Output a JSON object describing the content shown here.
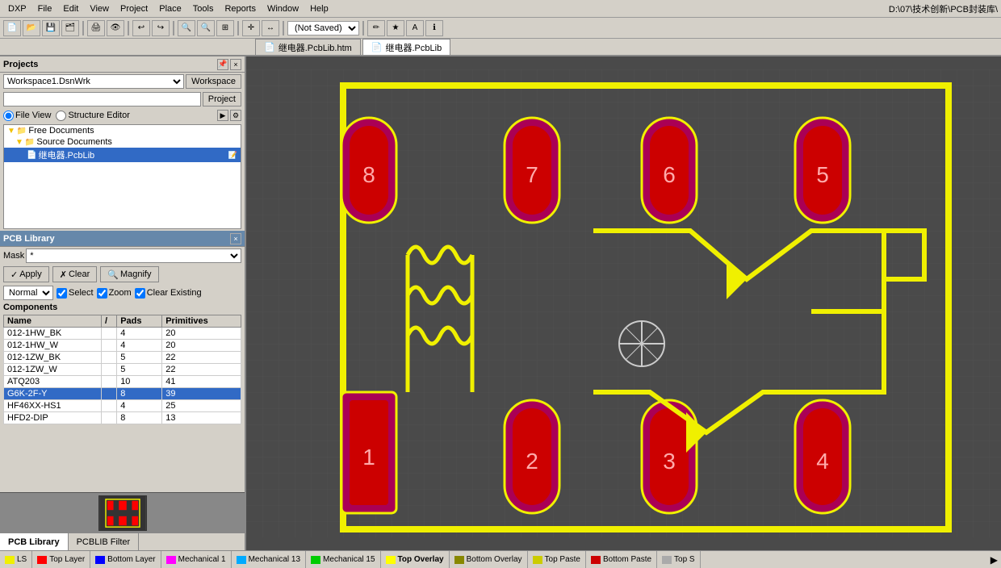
{
  "menubar": {
    "items": [
      "DXP",
      "File",
      "Edit",
      "View",
      "Project",
      "Place",
      "Tools",
      "Reports",
      "Window",
      "Help"
    ]
  },
  "toolbar": {
    "title_path": "D:\\07\\技术创新\\PCB封装库\\",
    "saved_state": "(Not Saved)"
  },
  "tabs": [
    {
      "label": "继电器.PcbLib.htm",
      "icon": "📄",
      "active": false
    },
    {
      "label": "继电器.PcbLib",
      "icon": "📄",
      "active": true
    }
  ],
  "projects": {
    "title": "Projects",
    "workspace_value": "Workspace1.DsnWrk",
    "workspace_btn": "Workspace",
    "project_btn": "Project",
    "view_file": "File View",
    "view_structure": "Structure Editor",
    "tree": [
      {
        "label": "Free Documents",
        "type": "folder",
        "indent": 0
      },
      {
        "label": "Source Documents",
        "type": "folder",
        "indent": 1
      },
      {
        "label": "继电器.PcbLib",
        "type": "file",
        "indent": 2,
        "selected": true
      }
    ]
  },
  "pcblib": {
    "title": "PCB Library",
    "mask_label": "Mask",
    "mask_value": "*",
    "apply_btn": "Apply",
    "clear_btn": "Clear",
    "magnify_btn": "Magnify",
    "normal_option": "Normal",
    "select_check": "Select",
    "zoom_check": "Zoom",
    "clear_existing_check": "Clear Existing",
    "components_header": "Components",
    "columns": [
      "Name",
      "/",
      "Pads",
      "Primitives"
    ],
    "rows": [
      {
        "name": "012-1HW_BK",
        "slash": "",
        "pads": "4",
        "primitives": "20",
        "selected": false
      },
      {
        "name": "012-1HW_W",
        "slash": "",
        "pads": "4",
        "primitives": "20",
        "selected": false
      },
      {
        "name": "012-1ZW_BK",
        "slash": "",
        "pads": "5",
        "primitives": "22",
        "selected": false
      },
      {
        "name": "012-1ZW_W",
        "slash": "",
        "pads": "5",
        "primitives": "22",
        "selected": false
      },
      {
        "name": "ATQ203",
        "slash": "",
        "pads": "10",
        "primitives": "41",
        "selected": false
      },
      {
        "name": "G6K-2F-Y",
        "slash": "",
        "pads": "8",
        "primitives": "39",
        "selected": true
      },
      {
        "name": "HF46XX-HS1",
        "slash": "",
        "pads": "4",
        "primitives": "25",
        "selected": false
      },
      {
        "name": "HFD2-DIP",
        "slash": "",
        "pads": "8",
        "primitives": "13",
        "selected": false
      }
    ]
  },
  "bottom_tabs": [
    {
      "label": "PCB Library",
      "active": true
    },
    {
      "label": "PCBLIB Filter",
      "active": false
    }
  ],
  "statusbar": {
    "layers": [
      {
        "color": "#f0f000",
        "label": "LS",
        "active": false
      },
      {
        "color": "#ff0000",
        "label": "Top Layer",
        "active": false
      },
      {
        "color": "#0000ff",
        "label": "Bottom Layer",
        "active": false
      },
      {
        "color": "#ff00ff",
        "label": "Mechanical 1",
        "active": false
      },
      {
        "color": "#00aaff",
        "label": "Mechanical 13",
        "active": false
      },
      {
        "color": "#00cc00",
        "label": "Mechanical 15",
        "active": false
      },
      {
        "color": "#ffff00",
        "label": "Top Overlay",
        "active": true
      },
      {
        "color": "#888800",
        "label": "Bottom Overlay",
        "active": false
      },
      {
        "color": "#cccc00",
        "label": "Top Paste",
        "active": false
      },
      {
        "color": "#cc0000",
        "label": "Bottom Paste",
        "active": false
      },
      {
        "color": "#aaaaaa",
        "label": "Top S",
        "active": false
      }
    ]
  }
}
